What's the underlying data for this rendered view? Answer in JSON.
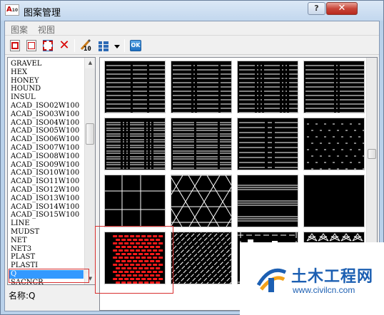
{
  "window": {
    "title": "图案管理",
    "app_icon_text": "A",
    "app_icon_sub": "10",
    "help_button": "?",
    "close_button": "✕"
  },
  "menu": [
    "图案",
    "视图"
  ],
  "toolbar": {
    "label_button_text": "10",
    "ok_text": "OK"
  },
  "pattern_list": {
    "items": [
      "GRAVEL",
      "HEX",
      "HONEY",
      "HOUND",
      "INSUL",
      "ACAD_ISO02W100",
      "ACAD_ISO03W100",
      "ACAD_ISO04W100",
      "ACAD_ISO05W100",
      "ACAD_ISO06W100",
      "ACAD_ISO07W100",
      "ACAD_ISO08W100",
      "ACAD_ISO09W100",
      "ACAD_ISO10W100",
      "ACAD_ISO11W100",
      "ACAD_ISO12W100",
      "ACAD_ISO13W100",
      "ACAD_ISO14W100",
      "ACAD_ISO15W100",
      "LINE",
      "MUDST",
      "NET",
      "NET3",
      "PLAST",
      "PLASTI",
      "Q",
      "SACNCR"
    ],
    "selected": "Q"
  },
  "name_label": "名称:Q",
  "grid": {
    "selected_index": 12,
    "tiles": [
      "dash-lines",
      "dash-dot-lines",
      "dash-lines-short",
      "dash-lines-long",
      "double-dash-lines",
      "double-dash-lines-2",
      "dash-long-short",
      "sparse-dots",
      "grid-square",
      "triangles",
      "triple-lines",
      "blank",
      "brick-red",
      "diagonal",
      "notched-border",
      "stars"
    ]
  },
  "watermark": {
    "title": "土木工程网",
    "url": "www.civilcn.com",
    "color": "#1c5fb2"
  },
  "colors": {
    "selection": "#3399ff",
    "highlight_box": "#d83030",
    "brick": "#ff1a1a"
  }
}
